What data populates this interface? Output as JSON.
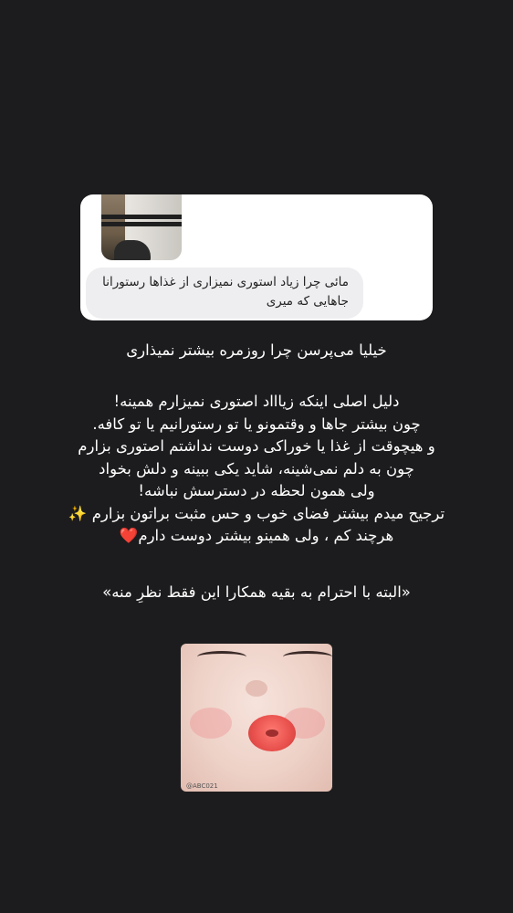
{
  "question_card": {
    "question_text_line1": "مائی چرا زیاد استوری نمیزاری از غذاها رستورانا",
    "question_text_line2": "جاهایی که میری"
  },
  "story": {
    "heading": "خیلیا می‌پرسن چرا روزمره بیشتر نمیذاری",
    "paragraph_lines": [
      "دلیل اصلی اینکه زیاااد اصتوری نمیزارم همینه!",
      "چون بیشتر جاها و وقتمونو یا تو رستورانیم یا تو کافه.",
      "و هیچوقت از غذا یا خوراکی دوست نداشتم اصتوری بزارم",
      "چون به دلم نمی‌شینه، شاید یکی ببینه و دلش بخواد",
      "ولی همون لحظه در دسترسش نباشه!",
      "ترجیح میدم بیشتر فضای خوب و حس مثبت براتون بزارم"
    ],
    "sparkle_emoji": "✨",
    "last_line": "هرچند کم ، ولی همینو بیشتر دوست دارم",
    "heart_emoji": "❤️",
    "footnote": "«البته با احترام به بقیه همکارا این فقط نظرِ منه»"
  },
  "photo": {
    "watermark": "@ABC021"
  },
  "colors": {
    "background": "#1c1c1e",
    "card": "#ffffff",
    "bubble": "#eeeef0",
    "text": "#ffffff"
  }
}
